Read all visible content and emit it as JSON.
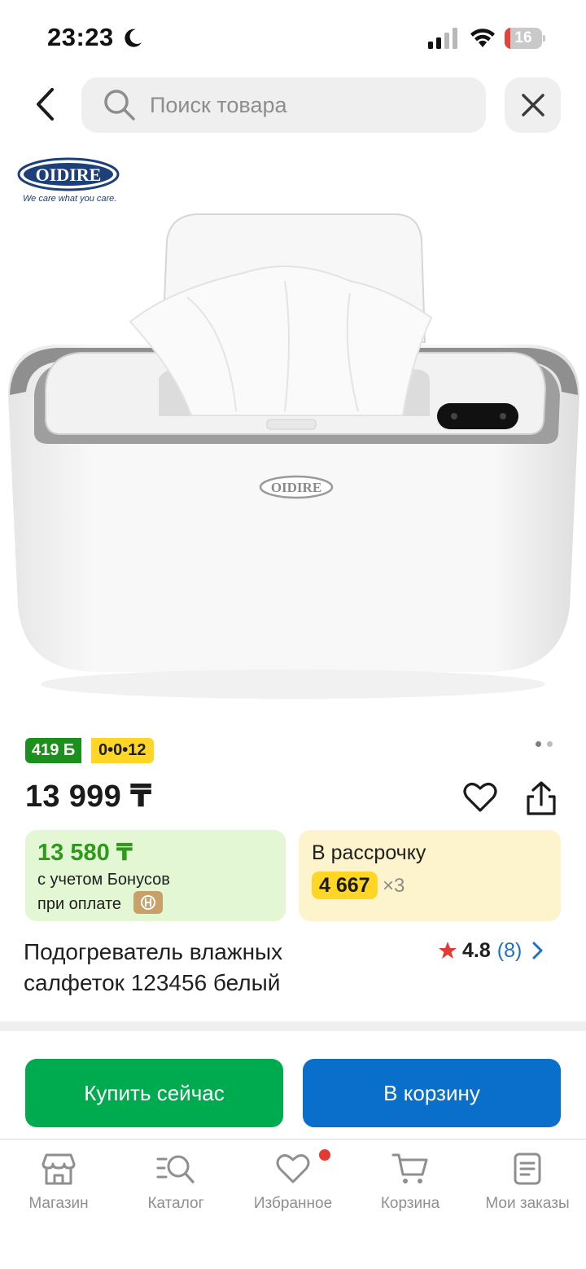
{
  "status_bar": {
    "time": "23:23",
    "battery": "16",
    "battery_level": 0.16
  },
  "header": {
    "search_placeholder": "Поиск товара"
  },
  "product": {
    "brand_logo_text": "OIDIRE",
    "brand_tagline": "We care what you care.",
    "bonus_badge": "419 Б",
    "plan_badge": "0•0•12",
    "image_count": 2,
    "image_active": 1,
    "price": "13 999 ₸",
    "bonus_price": "13 580 ₸",
    "bonus_line1": "с учетом Бонусов",
    "bonus_line2": "при оплате",
    "installment_label": "В рассрочку",
    "installment_amount": "4 667",
    "installment_times": "×3",
    "title": "Подогреватель влажных салфеток 123456 белый",
    "rating": "4.8",
    "rating_count": "(8)"
  },
  "actions": {
    "buy_now": "Купить сейчас",
    "add_to_cart": "В корзину"
  },
  "bottom_nav": {
    "items": [
      {
        "label": "Магазин",
        "icon": "store-icon"
      },
      {
        "label": "Каталог",
        "icon": "catalog-search-icon"
      },
      {
        "label": "Избранное",
        "icon": "heart-icon",
        "has_dot": true
      },
      {
        "label": "Корзина",
        "icon": "cart-icon"
      },
      {
        "label": "Мои заказы",
        "icon": "orders-icon"
      }
    ]
  },
  "colors": {
    "green_button": "#00ab4f",
    "blue_button": "#0a6fcb",
    "bonus_green": "#2d9a1c",
    "installment_yellow": "#ffd625",
    "rating_star": "#e53935",
    "link_blue": "#1e6fc7"
  }
}
